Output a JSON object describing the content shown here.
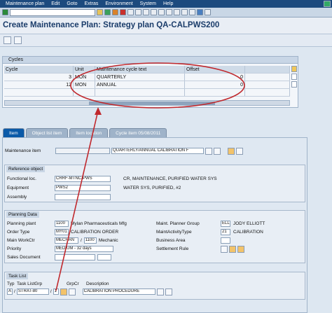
{
  "menu": {
    "items": [
      "Maintenance plan",
      "Edit",
      "Goto",
      "Extras",
      "Environment",
      "System",
      "Help"
    ]
  },
  "title": "Create Maintenance Plan: Strategy plan QA-CALPWS200",
  "cycles": {
    "heading": "Cycles",
    "columns": [
      "Cycle",
      "Unit",
      "Maintenance cycle text",
      "Offset"
    ],
    "rows": [
      {
        "cycle": "3",
        "unit": "MON",
        "text": "QUARTERLY",
        "offset": "0"
      },
      {
        "cycle": "12",
        "unit": "MON",
        "text": "ANNUAL",
        "offset": "0"
      }
    ]
  },
  "tabs": [
    "Item",
    "Object list item",
    "Item location",
    "Cycle item 05/08/2011"
  ],
  "item": {
    "label": "Maintenance item",
    "text": "QUARTERLY/ANNUAL CALIBRATION F"
  },
  "reference": {
    "heading": "Reference object",
    "functional_loc_label": "Functional loc.",
    "functional_loc_value": "CRRF-MTNC-PWS",
    "functional_loc_desc": "CR, MAINTENANCE, PURIFIED WATER SYS",
    "equipment_label": "Equipment",
    "equipment_value": "PWS2",
    "equipment_desc": "WATER SYS, PURIFIED, #2",
    "assembly_label": "Assembly"
  },
  "planning": {
    "heading": "Planning Data",
    "plant_label": "Planning plant",
    "plant_value": "1100",
    "plant_desc": "Mylan Pharmaceuticals Mfg",
    "order_type_label": "Order Type",
    "order_type_value": "MY01",
    "order_type_desc": "CALIBRATION ORDER",
    "workctr_label": "Main WorkCtr",
    "workctr_value": "MECHAN",
    "workctr_plant": "1100",
    "workctr_desc": "Mechanic",
    "priority_label": "Priority",
    "priority_value": "MEDIUM - 32 days",
    "sales_label": "Sales Document",
    "planner_label": "Maint. Planner Group",
    "planner_value": "ELL",
    "planner_desc": "JODY ELLIOTT",
    "activity_label": "MaintActivityType",
    "activity_value": "21",
    "activity_desc": "CALIBRATION",
    "business_label": "Business Area",
    "settlement_label": "Settlement Rule"
  },
  "tasklist": {
    "heading": "Task List",
    "col_typ": "Typ",
    "col_tlgrp": "Task ListGrp",
    "col_grpcr": "GrpCr",
    "col_desc": "Description",
    "typ_value": "A",
    "grp_value": "STRAT-80",
    "grpcr_value": "1",
    "desc_value": "CALIBRATION PROCEDURE"
  },
  "colors": {
    "menubar": "#1c4a7e",
    "title": "#1a3c6a",
    "tab_active": "#0b5aa8",
    "callout": "#c0282d"
  },
  "icons": [
    "save-icon",
    "back-icon",
    "exit-icon",
    "cancel-icon",
    "print-icon",
    "find-icon",
    "help-icon",
    "layout-icon"
  ]
}
